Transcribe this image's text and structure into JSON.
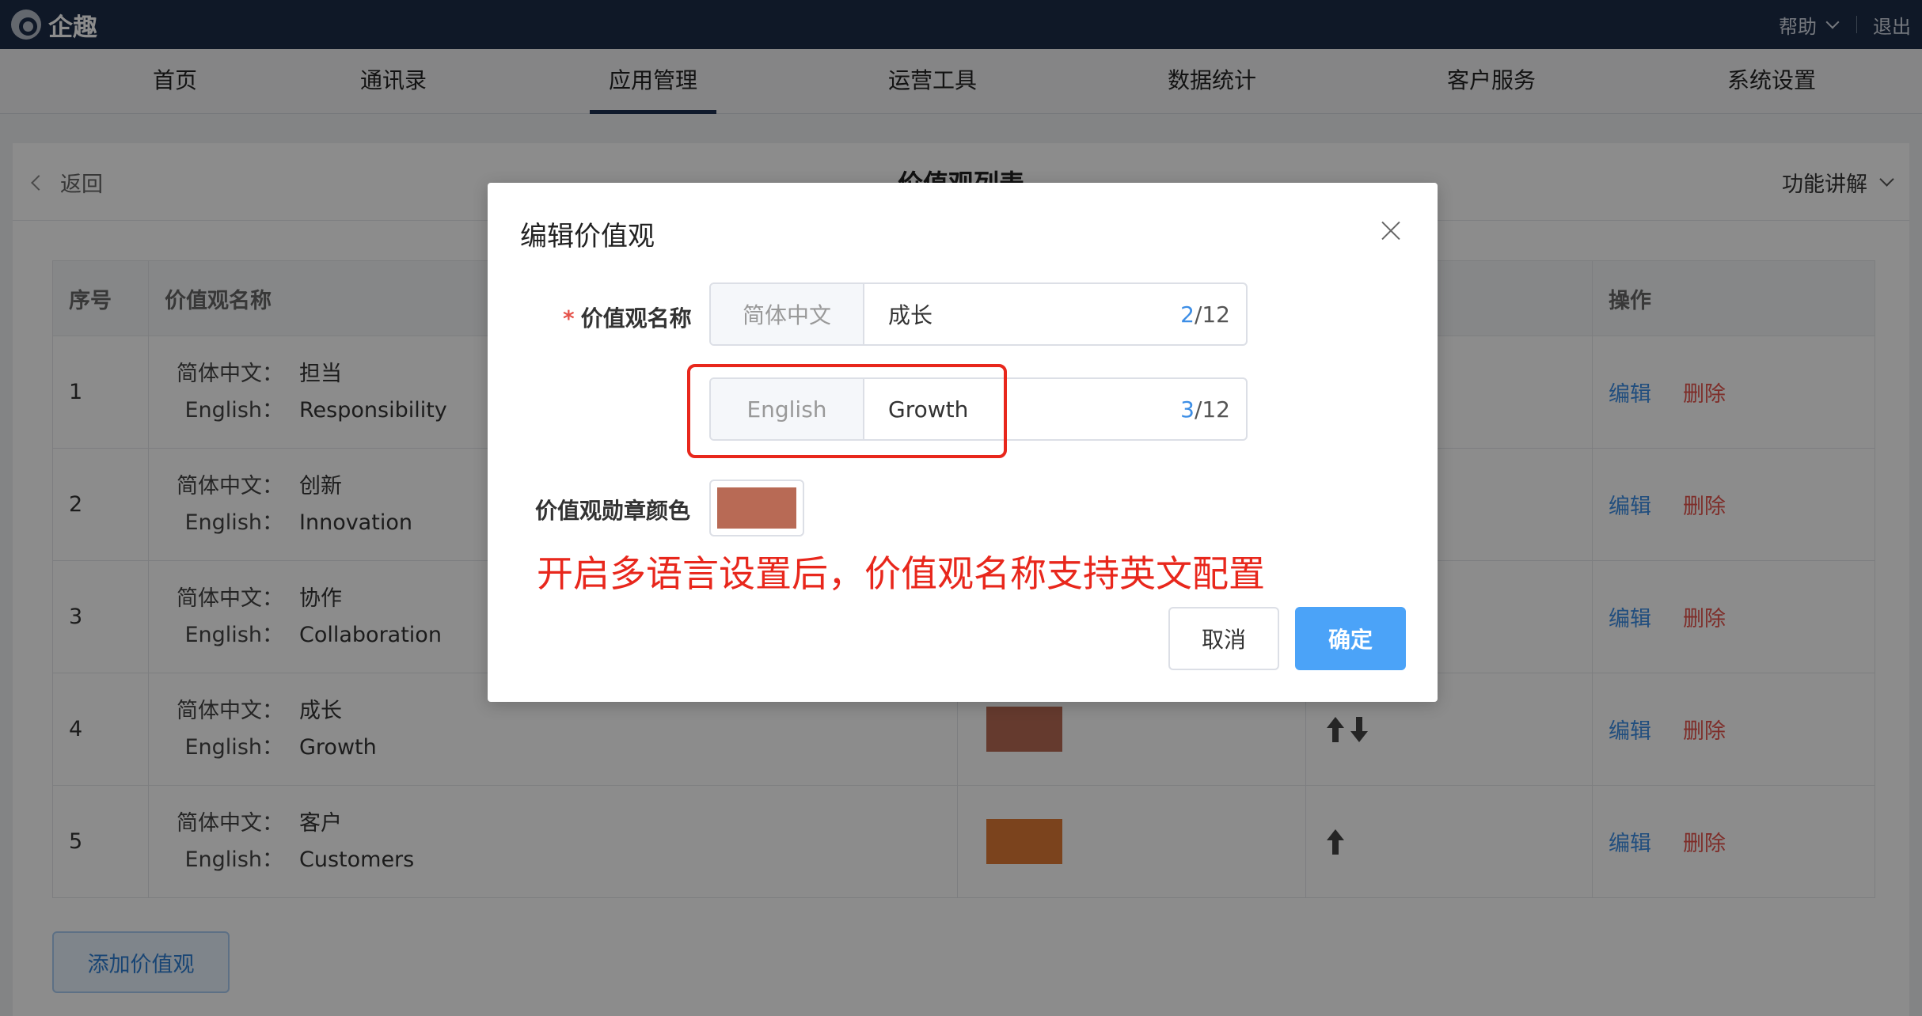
{
  "app": {
    "brand": "企趣"
  },
  "topbar": {
    "help": "帮助",
    "logout": "退出"
  },
  "nav": {
    "items": [
      {
        "label": "首页"
      },
      {
        "label": "通讯录"
      },
      {
        "label": "应用管理",
        "active": true
      },
      {
        "label": "运营工具"
      },
      {
        "label": "数据统计"
      },
      {
        "label": "客户服务"
      },
      {
        "label": "系统设置"
      }
    ]
  },
  "page": {
    "back": "返回",
    "title": "价值观列表",
    "func": "功能讲解"
  },
  "table": {
    "headers": {
      "index": "序号",
      "name": "价值观名称",
      "color": "",
      "sort": "",
      "actions": "操作"
    },
    "name_keys": {
      "zh": "简体中文：",
      "en": "English："
    },
    "action_labels": {
      "edit": "编辑",
      "delete": "删除"
    },
    "rows": [
      {
        "index": "1",
        "zh": "担当",
        "en": "Responsibility",
        "color": "",
        "arrows": ""
      },
      {
        "index": "2",
        "zh": "创新",
        "en": "Innovation",
        "color": "",
        "arrows": ""
      },
      {
        "index": "3",
        "zh": "协作",
        "en": "Collaboration",
        "color": "",
        "arrows": ""
      },
      {
        "index": "4",
        "zh": "成长",
        "en": "Growth",
        "color": "#b86a55",
        "arrows": "up-down"
      },
      {
        "index": "5",
        "zh": "客户",
        "en": "Customers",
        "color": "#e07a36",
        "arrows": "up"
      }
    ]
  },
  "add_button": "添加价值观",
  "modal": {
    "title": "编辑价值观",
    "name_label": "价值观名称",
    "required_mark": "*",
    "zh_input": {
      "prefix": "简体中文",
      "value": "成长",
      "count": "2",
      "max": "/12"
    },
    "en_input": {
      "prefix": "English",
      "value": "Growth",
      "count": "3",
      "max": "/12"
    },
    "color_label": "价值观勋章颜色",
    "badge_color": "#b86a55",
    "annotation": "开启多语言设置后，价值观名称支持英文配置",
    "cancel": "取消",
    "confirm": "确定"
  },
  "colors": {
    "topbar": "#1c2c48",
    "primary": "#4ba3f8",
    "link": "#3d8ee6",
    "danger": "#e5534b",
    "annotation": "#e8271c"
  }
}
